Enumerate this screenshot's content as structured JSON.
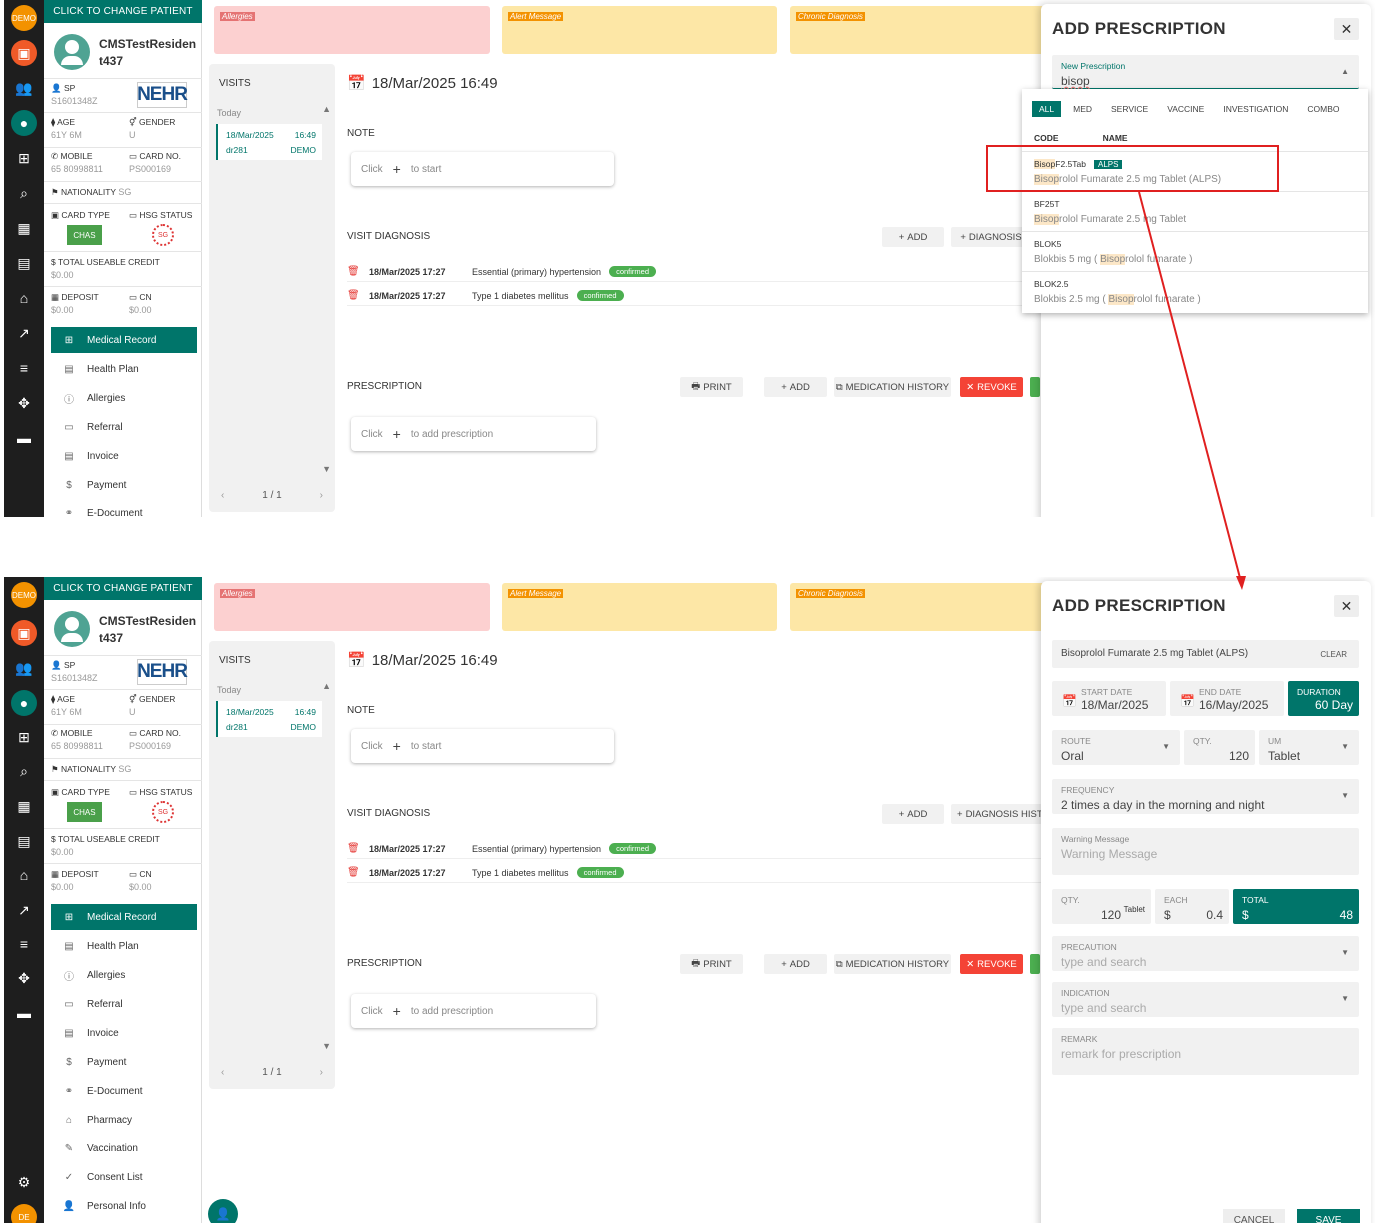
{
  "app": {
    "demo_badge": "DEMO",
    "change_patient": "CLICK TO CHANGE PATIENT",
    "bottom_badge": "DE"
  },
  "patient": {
    "name": "CMSTestResident437",
    "name_line1": "CMSTestResiden",
    "name_line2": "t437",
    "sp_label": "SP",
    "sp_value": "S1601348Z",
    "nehr": "NEHR",
    "age_label": "AGE",
    "age_value": "61Y 6M",
    "gender_label": "GENDER",
    "gender_value": "U",
    "mobile_label": "MOBILE",
    "mobile_value": "65 80998811",
    "card_no_label": "CARD NO.",
    "card_no_value": "PS000169",
    "nationality_label": "NATIONALITY",
    "nationality_value": "SG",
    "card_type_label": "CARD TYPE",
    "card_type_value": "CHAS",
    "hsg_label": "HSG STATUS",
    "hsg_value": "SG",
    "credit_label": "TOTAL USEABLE CREDIT",
    "credit_value": "$0.00",
    "deposit_label": "DEPOSIT",
    "deposit_value": "$0.00",
    "cn_label": "CN",
    "cn_value": "$0.00"
  },
  "menu": [
    {
      "label": "Medical Record",
      "icon": "plus-square-icon"
    },
    {
      "label": "Health Plan",
      "icon": "doc-icon"
    },
    {
      "label": "Allergies",
      "icon": "info-icon"
    },
    {
      "label": "Referral",
      "icon": "referral-icon"
    },
    {
      "label": "Invoice",
      "icon": "invoice-icon"
    },
    {
      "label": "Payment",
      "icon": "dollar-icon"
    },
    {
      "label": "E-Document",
      "icon": "link-icon"
    },
    {
      "label": "Pharmacy",
      "icon": "pharmacy-icon"
    },
    {
      "label": "Vaccination",
      "icon": "syringe-icon"
    },
    {
      "label": "Consent List",
      "icon": "check-icon"
    },
    {
      "label": "Personal Info",
      "icon": "person-icon"
    }
  ],
  "banners": {
    "allergies": "Allergies",
    "alert": "Alert Message",
    "chronic": "Chronic Diagnosis"
  },
  "visits": {
    "title": "VISITS",
    "today": "Today",
    "item": {
      "date": "18/Mar/2025",
      "time": "16:49",
      "doctor": "dr281",
      "clinic": "DEMO"
    },
    "pagination": "1 / 1"
  },
  "visit": {
    "datetime": "18/Mar/2025 16:49",
    "note_title": "NOTE",
    "click": "Click",
    "to_start": "to start",
    "diagnosis_title": "VISIT DIAGNOSIS",
    "add": "ADD",
    "diagnosis_history": "DIAGNOSIS HIST",
    "diagnosis_history_short": "DIAGNOSIS",
    "diagnoses": [
      {
        "date": "18/Mar/2025 17:27",
        "name": "Essential (primary) hypertension",
        "status": "confirmed"
      },
      {
        "date": "18/Mar/2025 17:27",
        "name": "Type 1 diabetes mellitus",
        "status": "confirmed"
      }
    ],
    "prescription_title": "PRESCRIPTION",
    "print": "PRINT",
    "medication_history": "MEDICATION HISTORY",
    "revoke": "REVOKE",
    "to_add_prescription": "to add prescription"
  },
  "dialog1": {
    "title": "ADD PRESCRIPTION",
    "new_prescription_label": "New Prescription",
    "search_value": "bisop",
    "filters": [
      "ALL",
      "MED",
      "SERVICE",
      "VACCINE",
      "INVESTIGATION",
      "COMBO"
    ],
    "col_code": "CODE",
    "col_name": "NAME",
    "results": [
      {
        "code_hl": "Bisop",
        "code_rest": "F2.5Tab",
        "tag": "ALPS",
        "name_pre": "",
        "name_hl": "Bisop",
        "name_post": "rolol Fumarate 2.5 mg Tablet (ALPS)"
      },
      {
        "code_hl": "",
        "code_rest": "BF25T",
        "tag": "",
        "name_pre": "",
        "name_hl": "Bisop",
        "name_post": "rolol Fumarate 2.5 mg Tablet"
      },
      {
        "code_hl": "",
        "code_rest": "BLOK5",
        "tag": "",
        "name_pre": "Blokbis 5 mg ( ",
        "name_hl": "Bisop",
        "name_post": "rolol fumarate )"
      },
      {
        "code_hl": "",
        "code_rest": "BLOK2.5",
        "tag": "",
        "name_pre": "Blokbis 2.5 mg ( ",
        "name_hl": "Bisop",
        "name_post": "rolol fumarate )"
      }
    ]
  },
  "dialog2": {
    "title": "ADD PRESCRIPTION",
    "selected": "Bisoprolol Fumarate 2.5 mg Tablet (ALPS)",
    "clear": "CLEAR",
    "start_date_label": "START DATE",
    "start_date": "18/Mar/2025",
    "end_date_label": "END DATE",
    "end_date": "16/May/2025",
    "duration_label": "DURATION",
    "duration": "60 Day",
    "route_label": "ROUTE",
    "route": "Oral",
    "qty_label": "QTY.",
    "qty": "120",
    "um_label": "UM",
    "um": "Tablet",
    "frequency_label": "FREQUENCY",
    "frequency": "2 times a day in the morning and night",
    "warning_label": "Warning Message",
    "warning_placeholder": "Warning Message",
    "qty2_label": "QTY.",
    "qty2": "120",
    "qty2_unit": "Tablet",
    "each_label": "EACH",
    "each_currency": "$",
    "each": "0.4",
    "total_label": "TOTAL",
    "total_currency": "$",
    "total": "48",
    "precaution_label": "PRECAUTION",
    "precaution_placeholder": "type and search",
    "indication_label": "INDICATION",
    "indication_placeholder": "type and search",
    "remark_label": "REMARK",
    "remark_placeholder": "remark for prescription",
    "cancel": "CANCEL",
    "save": "SAVE"
  },
  "colors": {
    "primary": "#00756a",
    "alert_red": "#f44336",
    "confirm_green": "#4caf50",
    "annotation_red": "#e02020"
  }
}
